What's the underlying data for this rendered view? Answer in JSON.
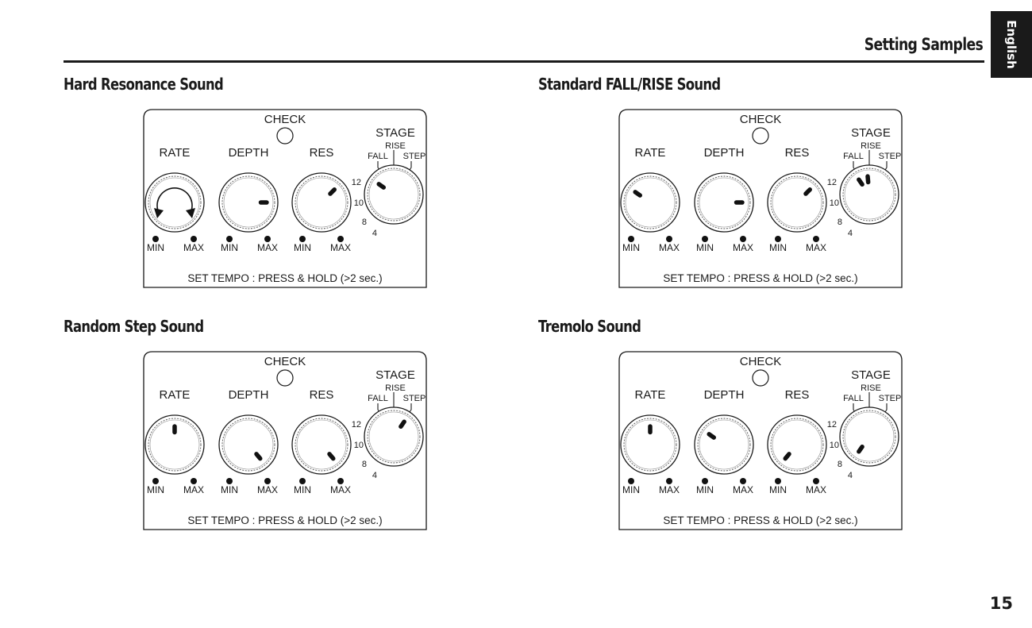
{
  "header": {
    "title": "Setting Samples",
    "language_tab": "English"
  },
  "page_number": "15",
  "panel_labels": {
    "check": "CHECK",
    "stage": "STAGE",
    "rise": "RISE",
    "fall": "FALL",
    "step": "STEP",
    "rate": "RATE",
    "depth": "DEPTH",
    "res": "RES",
    "min": "MIN",
    "max": "MAX",
    "stage_scale": [
      "12",
      "10",
      "8",
      "4"
    ],
    "footer": "SET TEMPO : PRESS & HOLD (>2 sec.)"
  },
  "samples": [
    {
      "title": "Hard Resonance Sound",
      "rate": {
        "mode": "sweep-arrows"
      },
      "depth_angle_deg": 90,
      "res_angle_deg": 45,
      "stage_angles_deg": [
        -55
      ]
    },
    {
      "title": "Standard FALL/RISE Sound",
      "rate": {
        "mode": "pointer",
        "angle_deg": -55
      },
      "depth_angle_deg": 90,
      "res_angle_deg": 45,
      "stage_angles_deg": [
        -35,
        -5
      ]
    },
    {
      "title": "Random Step Sound",
      "rate": {
        "mode": "pointer",
        "angle_deg": 0
      },
      "depth_angle_deg": 140,
      "res_angle_deg": 140,
      "stage_angles_deg": [
        35
      ]
    },
    {
      "title": "Tremolo Sound",
      "rate": {
        "mode": "pointer",
        "angle_deg": 0
      },
      "depth_angle_deg": -55,
      "res_angle_deg": -140,
      "stage_angles_deg": [
        -145
      ]
    }
  ]
}
